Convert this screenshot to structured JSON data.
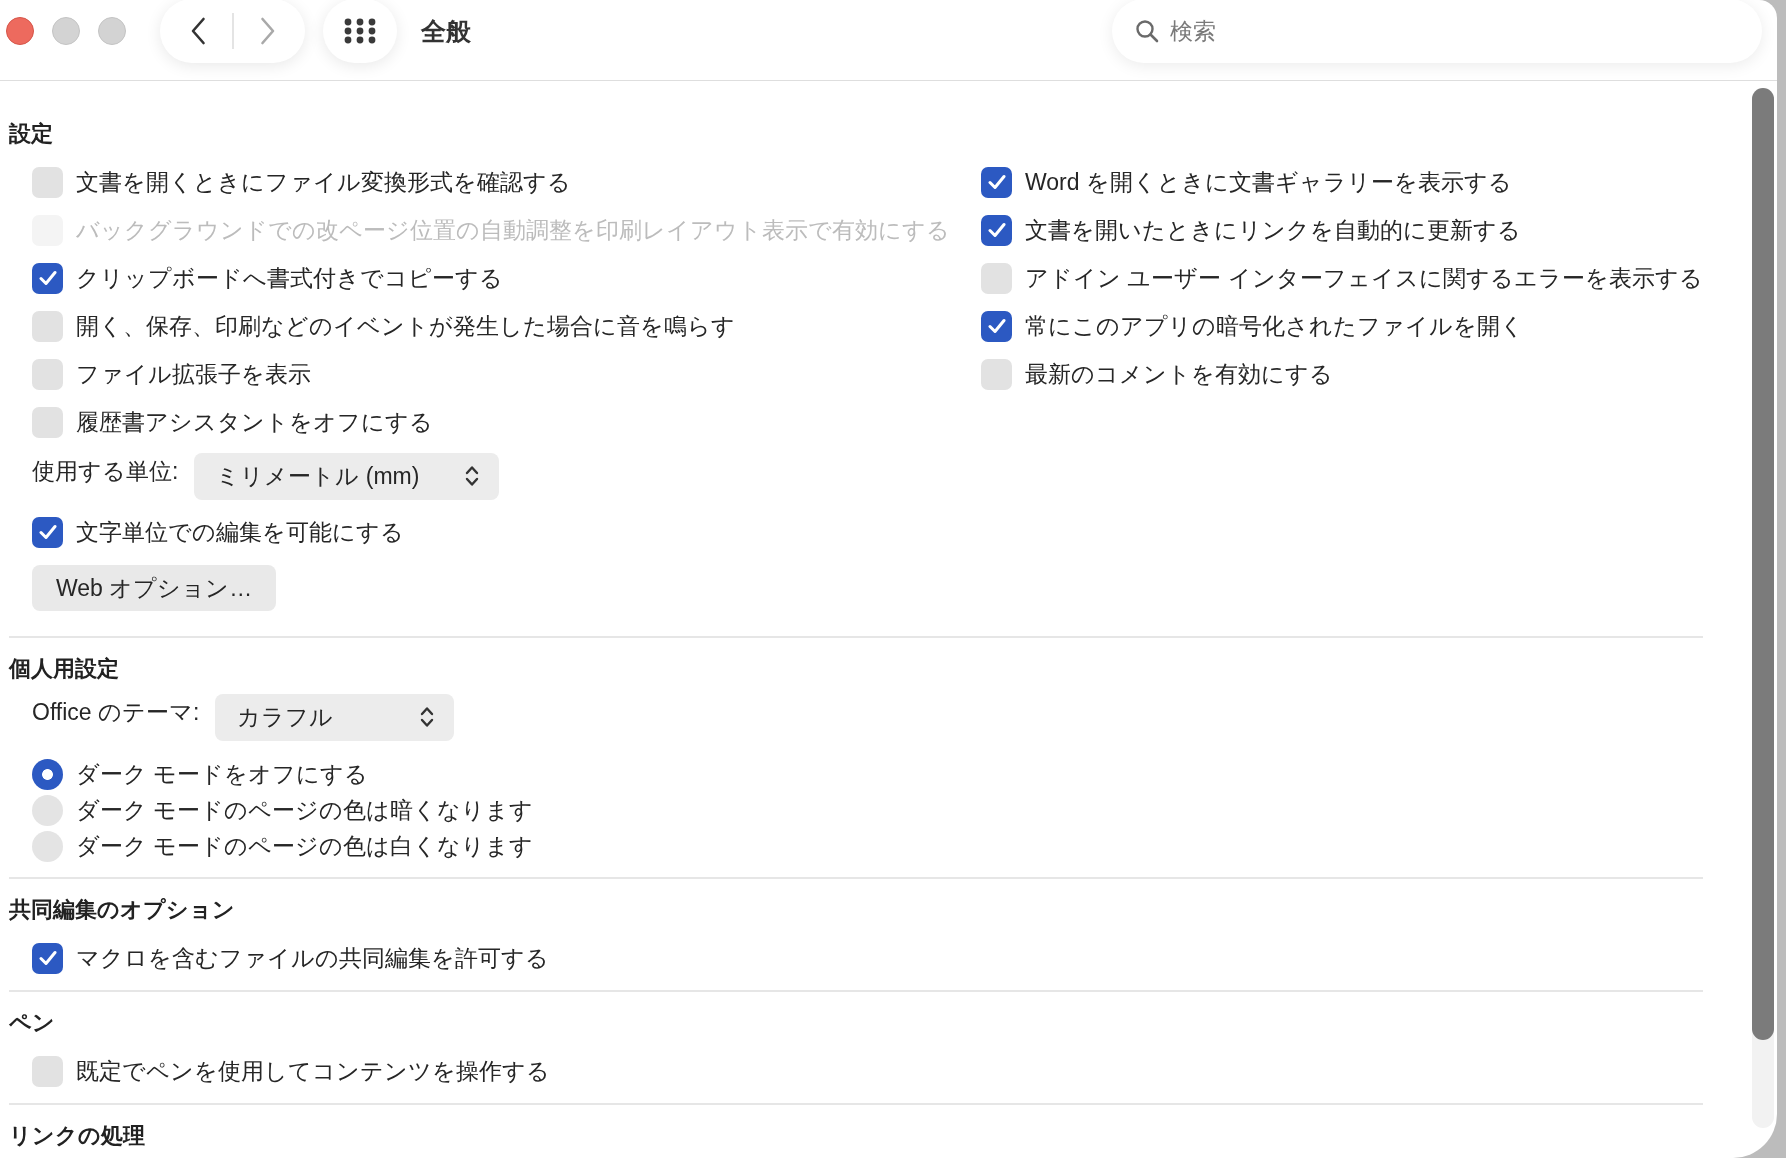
{
  "window": {
    "title": "全般"
  },
  "toolbar": {
    "back": {
      "disabled": false
    },
    "forward": {
      "disabled": true
    },
    "search": {
      "placeholder": "検索"
    }
  },
  "sections": [
    {
      "title": "設定",
      "left": [
        {
          "kind": "checkbox",
          "label": "文書を開くときにファイル変換形式を確認する",
          "checked": false,
          "disabled": false
        },
        {
          "kind": "checkbox",
          "label": "バックグラウンドでの改ページ位置の自動調整を印刷レイアウト表示で有効にする",
          "checked": false,
          "disabled": true
        },
        {
          "kind": "checkbox",
          "label": "クリップボードへ書式付きでコピーする",
          "checked": true,
          "disabled": false
        },
        {
          "kind": "checkbox",
          "label": "開く、保存、印刷などのイベントが発生した場合に音を鳴らす",
          "checked": false,
          "disabled": false
        },
        {
          "kind": "checkbox",
          "label": "ファイル拡張子を表示",
          "checked": false,
          "disabled": false
        },
        {
          "kind": "checkbox",
          "label": "履歴書アシスタントをオフにする",
          "checked": false,
          "disabled": false
        },
        {
          "kind": "select",
          "label": "使用する単位:",
          "value": "ミリメートル (mm)"
        },
        {
          "kind": "checkbox",
          "label": "文字単位での編集を可能にする",
          "checked": true,
          "disabled": false
        },
        {
          "kind": "button",
          "label": "Web オプション…"
        }
      ],
      "right": [
        {
          "kind": "checkbox",
          "label": "Word を開くときに文書ギャラリーを表示する",
          "checked": true,
          "disabled": false
        },
        {
          "kind": "checkbox",
          "label": "文書を開いたときにリンクを自動的に更新する",
          "checked": true,
          "disabled": false
        },
        {
          "kind": "checkbox",
          "label": "アドイン ユーザー インターフェイスに関するエラーを表示する",
          "checked": false,
          "disabled": false
        },
        {
          "kind": "checkbox",
          "label": "常にこのアプリの暗号化されたファイルを開く",
          "checked": true,
          "disabled": false
        },
        {
          "kind": "checkbox",
          "label": "最新のコメントを有効にする",
          "checked": false,
          "disabled": false
        }
      ]
    },
    {
      "title": "個人用設定",
      "left": [
        {
          "kind": "select",
          "label": "Office のテーマ:",
          "value": "カラフル"
        },
        {
          "kind": "radio",
          "label": "ダーク モードをオフにする",
          "selected": true
        },
        {
          "kind": "radio",
          "label": "ダーク モードのページの色は暗くなります",
          "selected": false
        },
        {
          "kind": "radio",
          "label": "ダーク モードのページの色は白くなります",
          "selected": false
        }
      ]
    },
    {
      "title": "共同編集のオプション",
      "left": [
        {
          "kind": "checkbox",
          "label": "マクロを含むファイルの共同編集を許可する",
          "checked": true,
          "disabled": false
        }
      ]
    },
    {
      "title": "ペン",
      "left": [
        {
          "kind": "checkbox",
          "label": "既定でペンを使用してコンテンツを操作する",
          "checked": false,
          "disabled": false
        }
      ]
    },
    {
      "title": "リンクの処理"
    }
  ]
}
